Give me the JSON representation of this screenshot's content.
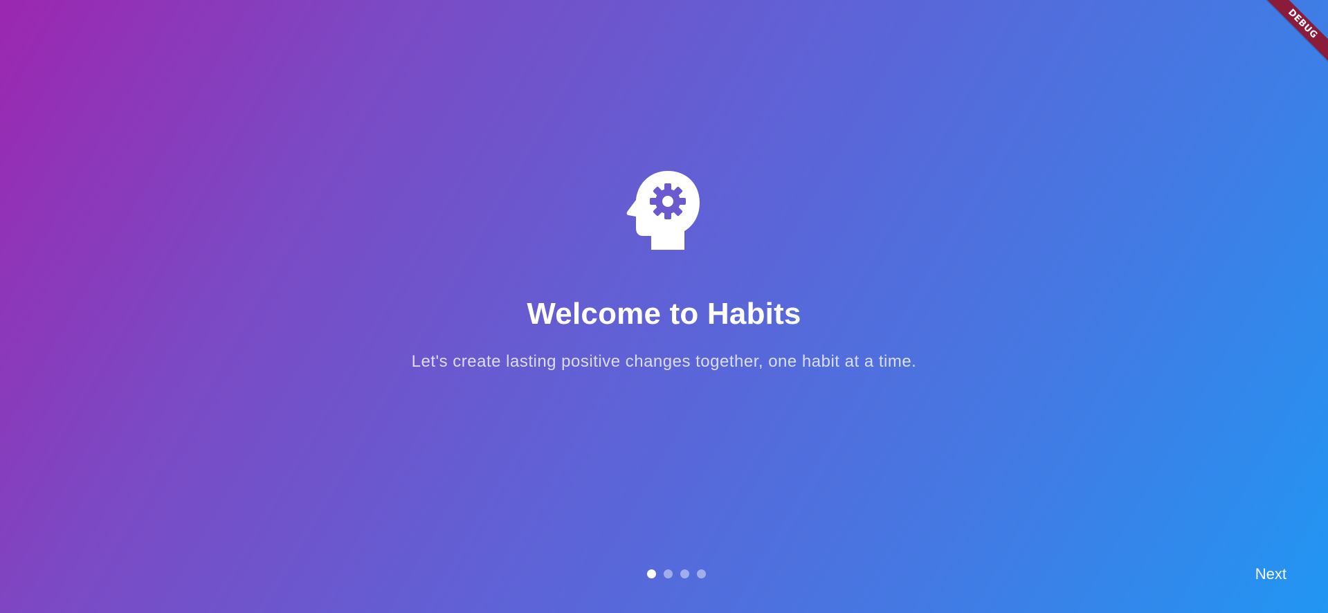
{
  "onboarding": {
    "icon": "psychology-head-gear-icon",
    "title": "Welcome to Habits",
    "subtitle": "Let's create lasting positive changes together, one habit at a time.",
    "page_count": 4,
    "current_page": 1,
    "next_label": "Next"
  },
  "debug_banner": {
    "label": "DEBUG"
  },
  "colors": {
    "gradient_start": "#9c27b0",
    "gradient_end": "#2196f3",
    "text": "#ffffff",
    "banner": "#8b1b3a"
  }
}
